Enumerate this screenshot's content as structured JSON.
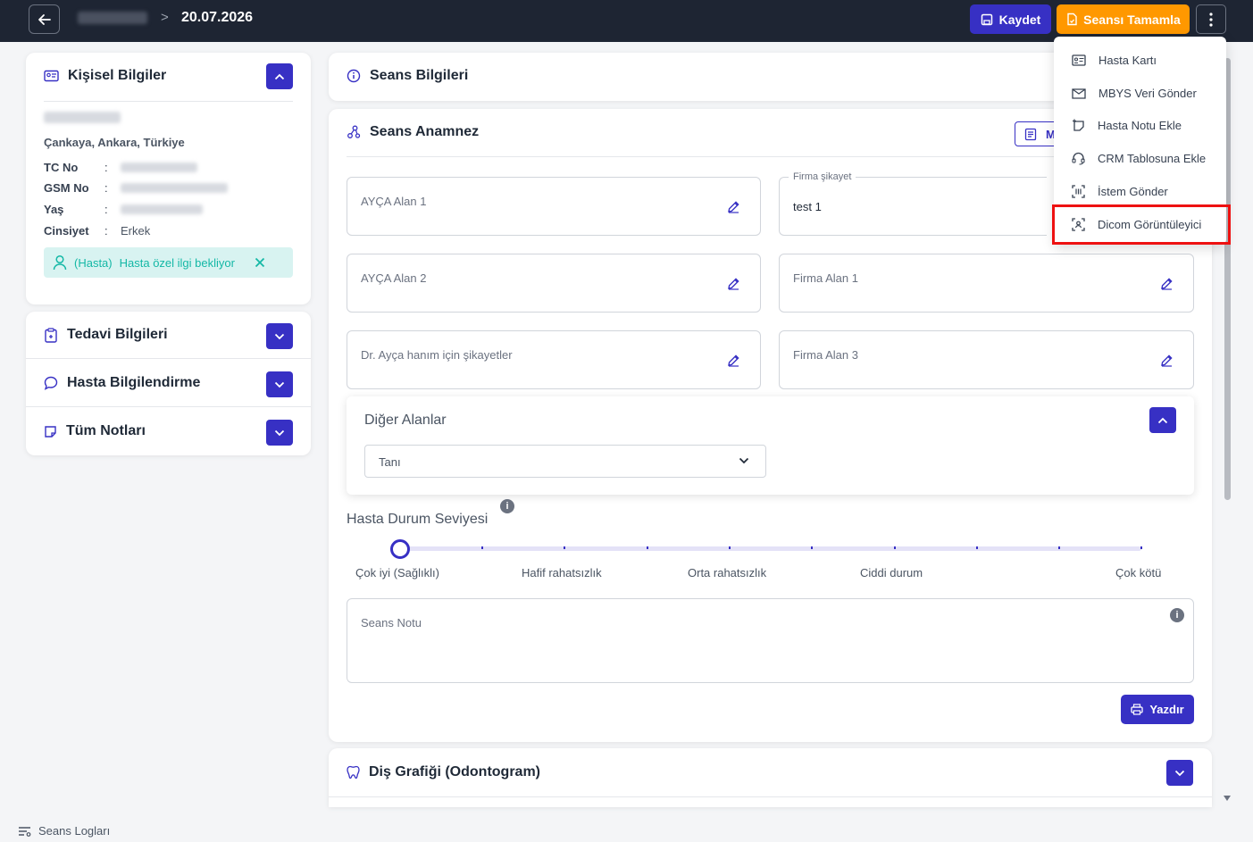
{
  "header": {
    "date": "20.07.2026",
    "separator": ">",
    "save_label": "Kaydet",
    "complete_label": "Seansı Tamamla"
  },
  "left": {
    "personal_title": "Kişisel Bilgiler",
    "address": "Çankaya, Ankara, Türkiye",
    "tc_label": "TC No",
    "gsm_label": "GSM No",
    "age_label": "Yaş",
    "gender_label": "Cinsiyet",
    "colon": ":",
    "gender_value": "Erkek",
    "badge_role": "(Hasta)",
    "badge_text": "Hasta özel ilgi bekliyor",
    "treatment_title": "Tedavi Bilgileri",
    "informing_title": "Hasta Bilgilendirme",
    "notes_title": "Tüm Notları"
  },
  "main": {
    "session_info_title": "Seans Bilgileri",
    "anamnez_title": "Seans Anamnez",
    "anamnez_button_partial": "M",
    "fields": {
      "ayca1": "AYÇA Alan 1",
      "firma_sikayet_label": "Firma şikayet",
      "firma_sikayet_value": "test 1",
      "ayca2": "AYÇA Alan 2",
      "firma1": "Firma Alan 1",
      "dr_ayca": "Dr. Ayça hanım için şikayetler",
      "firma3": "Firma Alan 3"
    },
    "other_title": "Diğer Alanlar",
    "other_select_value": "Tanı",
    "status_title": "Hasta Durum Seviyesi",
    "status_level": 0,
    "status_labels": [
      "Çok iyi (Sağlıklı)",
      "Hafif rahatsızlık",
      "Orta rahatsızlık",
      "Ciddi durum",
      "Çok kötü"
    ],
    "note_placeholder": "Seans Notu",
    "print_label": "Yazdır",
    "odontogram_title": "Diş Grafiği (Odontogram)"
  },
  "menu": {
    "items": [
      "Hasta Kartı",
      "MBYS Veri Gönder",
      "Hasta Notu Ekle",
      "CRM Tablosuna Ekle",
      "İstem Gönder",
      "Dicom Görüntüleyici"
    ]
  },
  "footer": {
    "logs_label": "Seans Logları"
  },
  "colors": {
    "primary": "#3730c4",
    "orange": "#ff9800",
    "topbar": "#1e2533",
    "badge_bg": "#d8f3f1",
    "badge_text": "#14b8a6",
    "highlight": "#ee1111"
  }
}
